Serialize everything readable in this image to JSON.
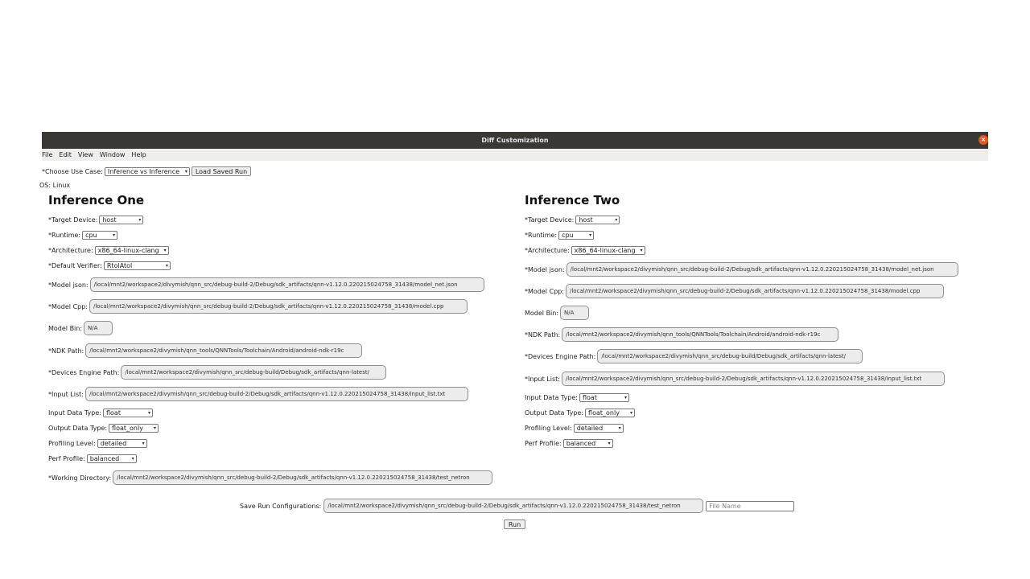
{
  "window": {
    "title": "Diff Customization",
    "close_glyph": "×",
    "menu": [
      "File",
      "Edit",
      "View",
      "Window",
      "Help"
    ]
  },
  "top": {
    "use_case_label": "*Choose Use Case:",
    "use_case_value": "Inference vs Inference",
    "load_button": "Load Saved Run",
    "os_label": "OS: Linux"
  },
  "left": {
    "heading": "Inference One",
    "target_device_label": "*Target Device:",
    "target_device_value": "host",
    "runtime_label": "*Runtime:",
    "runtime_value": "cpu",
    "architecture_label": "*Architecture:",
    "architecture_value": "x86_64-linux-clang",
    "verifier_label": "*Default Verifier:",
    "verifier_value": "RtolAtol",
    "model_json_label": "*Model json:",
    "model_json_value": "/local/mnt2/workspace2/divymish/qnn_src/debug-build-2/Debug/sdk_artifacts/qnn-v1.12.0.220215024758_31438/model_net.json",
    "model_cpp_label": "*Model Cpp:",
    "model_cpp_value": "/local/mnt2/workspace2/divymish/qnn_src/debug-build-2/Debug/sdk_artifacts/qnn-v1.12.0.220215024758_31438/model.cpp",
    "model_bin_label": "Model Bin:",
    "model_bin_value": "N/A",
    "ndk_label": "*NDK Path:",
    "ndk_value": "/local/mnt2/workspace2/divymish/qnn_tools/QNNTools/Toolchain/Android/android-ndk-r19c",
    "engine_label": "*Devices Engine Path:",
    "engine_value": "/local/mnt2/workspace2/divymish/qnn_src/debug-build/Debug/sdk_artifacts/qnn-latest/",
    "input_list_label": "*Input List:",
    "input_list_value": "/local/mnt2/workspace2/divymish/qnn_src/debug-build-2/Debug/sdk_artifacts/qnn-v1.12.0.220215024758_31438/input_list.txt",
    "input_type_label": "Input Data Type:",
    "input_type_value": "float",
    "output_type_label": "Output Data Type:",
    "output_type_value": "float_only",
    "profiling_label": "Profiling Level:",
    "profiling_value": "detailed",
    "perf_label": "Perf Profile:",
    "perf_value": "balanced",
    "workdir_label": "*Working Directory:",
    "workdir_value": "/local/mnt2/workspace2/divymish/qnn_src/debug-build-2/Debug/sdk_artifacts/qnn-v1.12.0.220215024758_31438/test_netron"
  },
  "right": {
    "heading": "Inference Two",
    "target_device_label": "*Target Device:",
    "target_device_value": "host",
    "runtime_label": "*Runtime:",
    "runtime_value": "cpu",
    "architecture_label": "*Architecture:",
    "architecture_value": "x86_64-linux-clang",
    "model_json_label": "*Model json:",
    "model_json_value": "/local/mnt2/workspace2/divymish/qnn_src/debug-build-2/Debug/sdk_artifacts/qnn-v1.12.0.220215024758_31438/model_net.json",
    "model_cpp_label": "*Model Cpp:",
    "model_cpp_value": "/local/mnt2/workspace2/divymish/qnn_src/debug-build-2/Debug/sdk_artifacts/qnn-v1.12.0.220215024758_31438/model.cpp",
    "model_bin_label": "Model Bin:",
    "model_bin_value": "N/A",
    "ndk_label": "*NDK Path:",
    "ndk_value": "/local/mnt2/workspace2/divymish/qnn_tools/QNNTools/Toolchain/Android/android-ndk-r19c",
    "engine_label": "*Devices Engine Path:",
    "engine_value": "/local/mnt2/workspace2/divymish/qnn_src/debug-build/Debug/sdk_artifacts/qnn-latest/",
    "input_list_label": "*Input List:",
    "input_list_value": "/local/mnt2/workspace2/divymish/qnn_src/debug-build-2/Debug/sdk_artifacts/qnn-v1.12.0.220215024758_31438/input_list.txt",
    "input_type_label": "Input Data Type:",
    "input_type_value": "float",
    "output_type_label": "Output Data Type:",
    "output_type_value": "float_only",
    "profiling_label": "Profiling Level:",
    "profiling_value": "detailed",
    "perf_label": "Perf Profile:",
    "perf_value": "balanced"
  },
  "bottom": {
    "save_label": "Save Run Configurations:",
    "save_path": "/local/mnt2/workspace2/divymish/qnn_src/debug-build-2/Debug/sdk_artifacts/qnn-v1.12.0.220215024758_31438/test_netron",
    "file_name_placeholder": "File Name",
    "run_button": "Run"
  },
  "icons": {
    "dropdown": "chevron-down-icon",
    "close": "close-icon"
  },
  "colors": {
    "titlebar": "#3a3835",
    "close": "#e9541f",
    "menubar": "#efeeec"
  }
}
